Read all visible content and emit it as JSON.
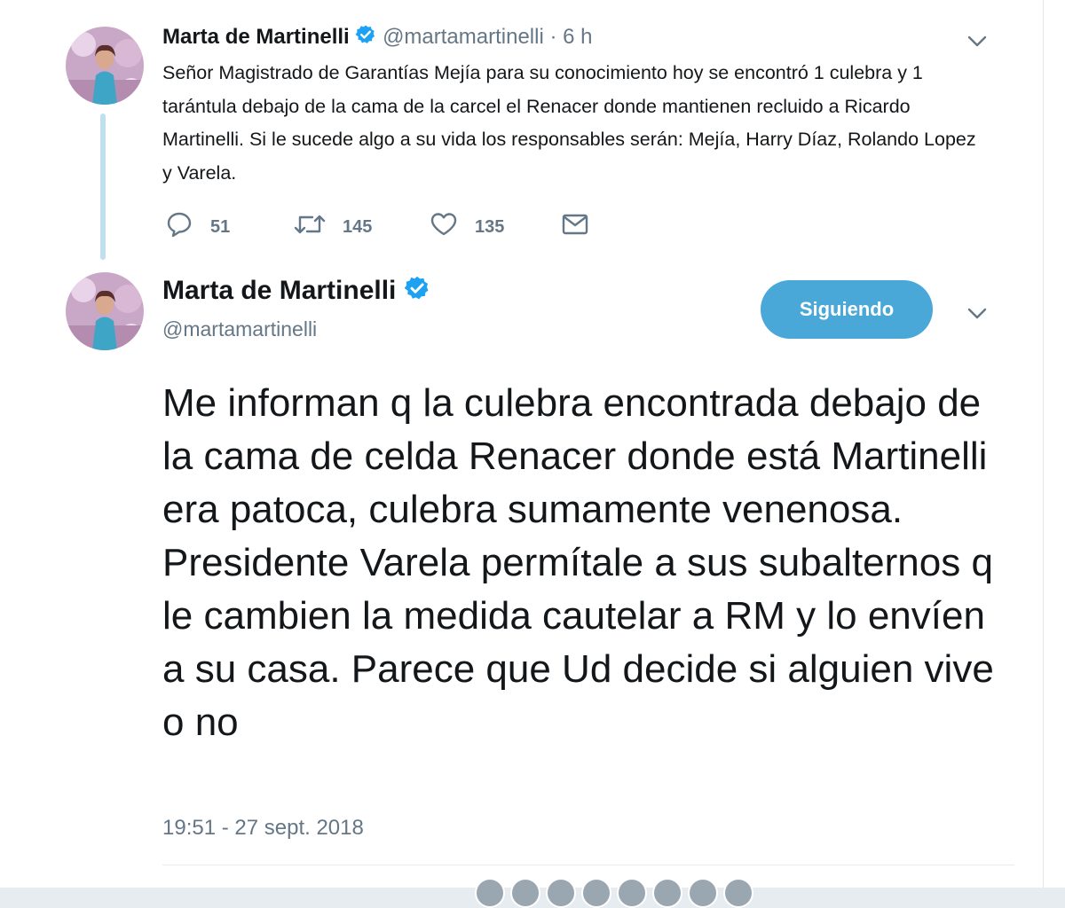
{
  "tweet1": {
    "display_name": "Marta de Martinelli",
    "handle": "@martamartinelli",
    "separator": "·",
    "time_ago": "6 h",
    "text": "Señor Magistrado de Garantías Mejía para su conocimiento hoy se encontró 1 culebra y 1 tarántula debajo de la cama de la carcel el Renacer donde mantienen recluido a Ricardo Martinelli. Si le sucede algo a su vida los responsables serán: Mejía, Harry Díaz, Rolando Lopez y Varela.",
    "replies": "51",
    "retweets": "145",
    "likes": "135"
  },
  "tweet2": {
    "display_name": "Marta de Martinelli",
    "handle": "@martamartinelli",
    "follow_label": "Siguiendo",
    "text": "Me informan q la culebra encontrada debajo de la cama de celda Renacer donde está Martinelli era patoca, culebra sumamente venenosa. Presidente Varela permítale a sus subalternos q le cambien la medida cautelar a RM y lo envíen a su casa. Parece que Ud decide si alguien vive o no",
    "timestamp": "19:51 - 27 sept. 2018"
  },
  "colors": {
    "accent": "#1da1f2",
    "follow_button": "#4aa8d8",
    "muted": "#657786",
    "text": "#14171a",
    "thread_line": "#bfe0f0"
  },
  "icons": [
    "verified-badge-icon",
    "chevron-down-icon",
    "reply-icon",
    "retweet-icon",
    "like-icon",
    "direct-message-icon"
  ]
}
